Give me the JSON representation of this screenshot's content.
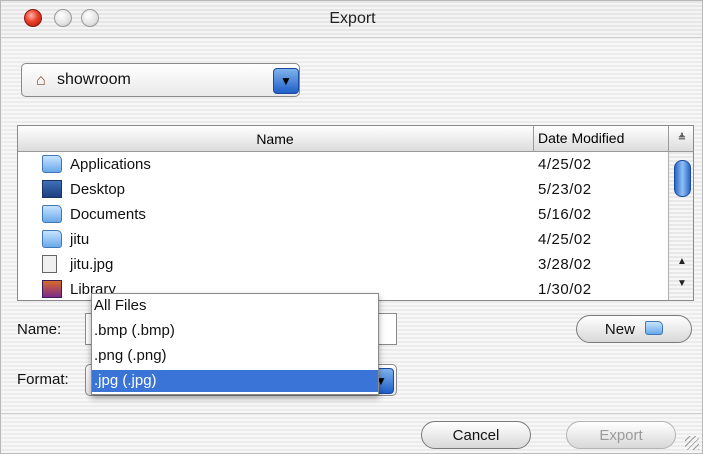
{
  "window": {
    "title": "Export"
  },
  "location": {
    "label": "showroom",
    "icon": "home-icon"
  },
  "browser": {
    "columns": {
      "name": "Name",
      "date": "Date Modified"
    },
    "files": [
      {
        "name": "Applications",
        "date": "4/25/02",
        "icon": "folder-icon"
      },
      {
        "name": "Desktop",
        "date": "5/23/02",
        "icon": "desktop-icon"
      },
      {
        "name": "Documents",
        "date": "5/16/02",
        "icon": "folder-icon"
      },
      {
        "name": "jitu",
        "date": "4/25/02",
        "icon": "folder-icon"
      },
      {
        "name": "jitu.jpg",
        "date": "3/28/02",
        "icon": "image-file-icon"
      },
      {
        "name": "Library",
        "date": "1/30/02",
        "icon": "library-icon"
      }
    ]
  },
  "form": {
    "name_label": "Name:",
    "name_value": "",
    "format_label": "Format:",
    "format_selected": ".jpg (.jpg)"
  },
  "format_menu": {
    "options": [
      "All Files",
      ".bmp (.bmp)",
      ".png (.png)",
      ".jpg (.jpg)"
    ],
    "selected_index": 3
  },
  "buttons": {
    "new": "New",
    "cancel": "Cancel",
    "export": "Export"
  },
  "colors": {
    "selection": "#3a74d6",
    "close_light": "#e8402a",
    "accent_blue": "#2b67c8"
  }
}
